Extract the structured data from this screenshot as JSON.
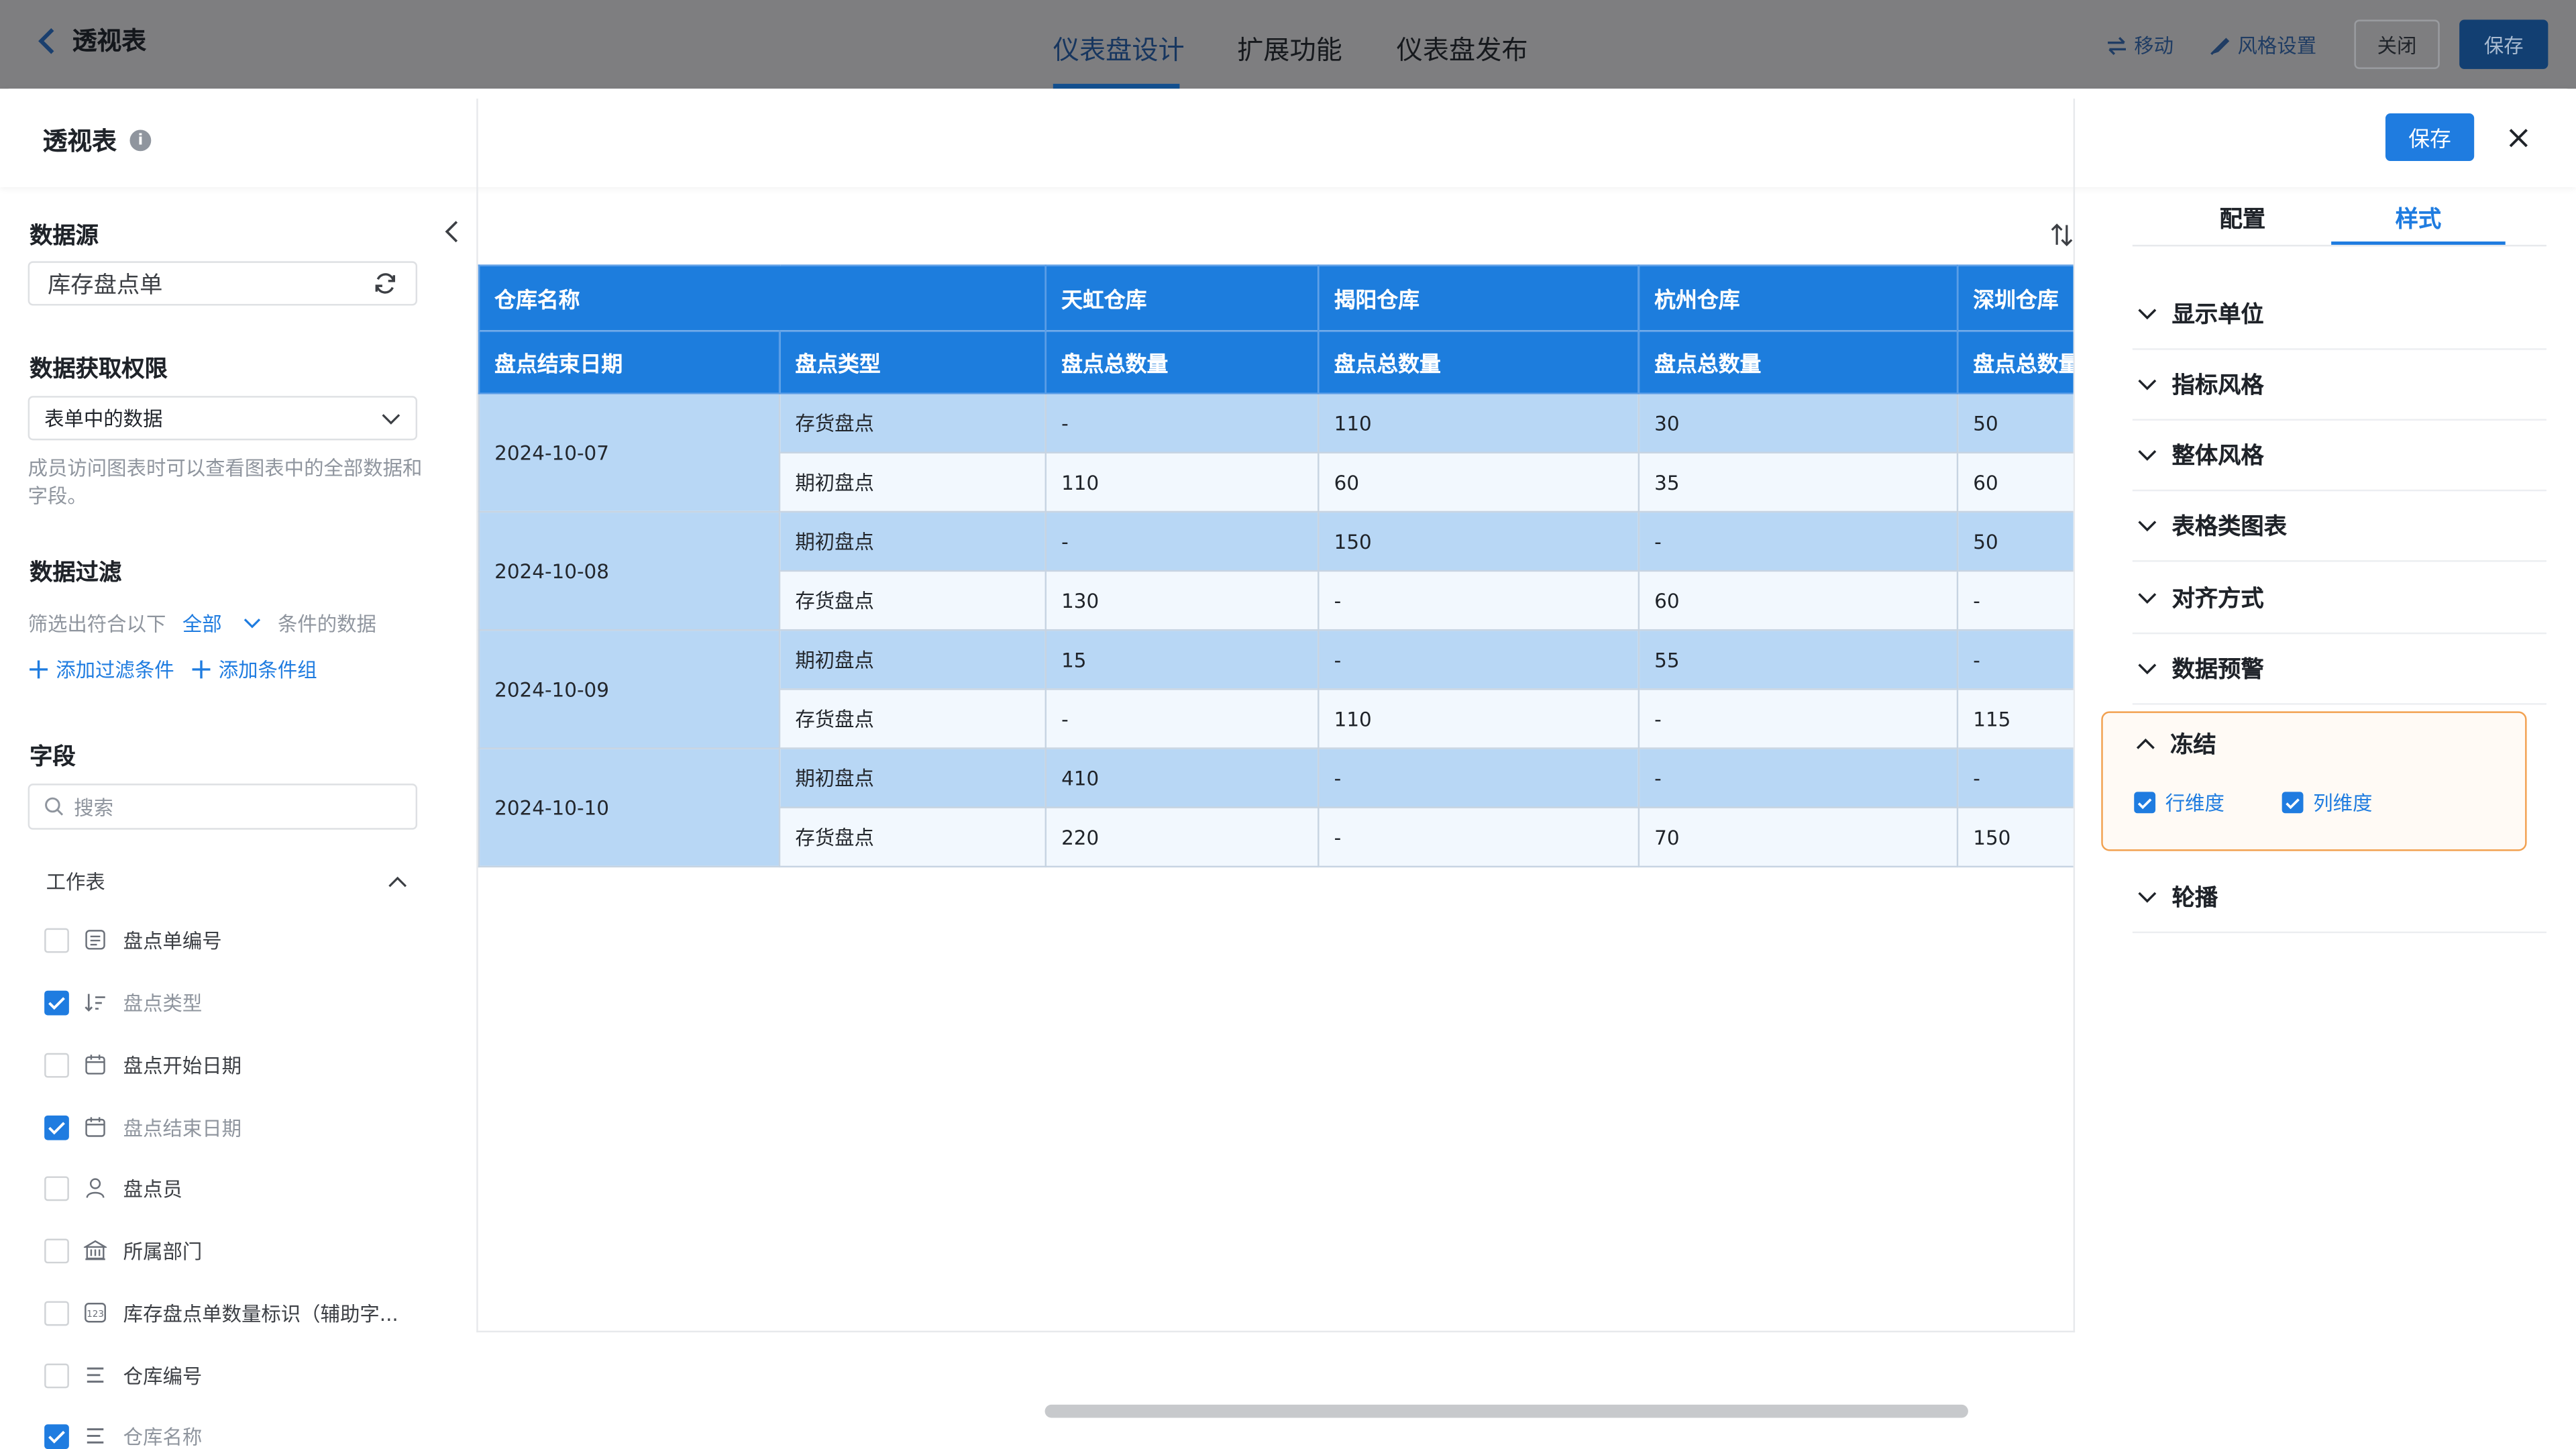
{
  "topbar": {
    "back_label": "透视表",
    "nav_tabs": [
      "仪表盘设计",
      "扩展功能",
      "仪表盘发布"
    ],
    "move_label": "移动",
    "style_label": "风格设置",
    "close_label": "关闭",
    "save_label": "保存"
  },
  "modal": {
    "title": "透视表",
    "info": "i",
    "save_label": "保存"
  },
  "left": {
    "datasource_title": "数据源",
    "datasource_value": "库存盘点单",
    "permission_title": "数据获取权限",
    "permission_value": "表单中的数据",
    "permission_hint": "成员访问图表时可以查看图表中的全部数据和字段。",
    "filter_title": "数据过滤",
    "filter_prefix": "筛选出符合以下",
    "filter_mode": "全部",
    "filter_suffix": "条件的数据",
    "add_filter": "添加过滤条件",
    "add_group": "添加条件组",
    "fields_title": "字段",
    "search_placeholder": "搜索",
    "worksheet_label": "工作表",
    "fields": [
      {
        "label": "盘点单编号",
        "checked": false,
        "icon": "text-field-icon"
      },
      {
        "label": "盘点类型",
        "checked": true,
        "icon": "sort-list-icon"
      },
      {
        "label": "盘点开始日期",
        "checked": false,
        "icon": "calendar-icon"
      },
      {
        "label": "盘点结束日期",
        "checked": true,
        "icon": "calendar-icon"
      },
      {
        "label": "盘点员",
        "checked": false,
        "icon": "user-icon"
      },
      {
        "label": "所属部门",
        "checked": false,
        "icon": "department-icon"
      },
      {
        "label": "库存盘点单数量标识（辅助字...",
        "checked": false,
        "icon": "number-icon"
      },
      {
        "label": "仓库编号",
        "checked": false,
        "icon": "lines-icon"
      },
      {
        "label": "仓库名称",
        "checked": true,
        "icon": "lines-icon"
      }
    ]
  },
  "table": {
    "corner_label": "仓库名称",
    "row_header_1": "盘点结束日期",
    "row_header_2": "盘点类型",
    "warehouses": [
      "天虹仓库",
      "揭阳仓库",
      "杭州仓库",
      "深圳仓库"
    ],
    "measure": "盘点总数量",
    "rows": [
      {
        "date": "2024-10-07",
        "type": "存货盘点",
        "values": [
          "-",
          "110",
          "30",
          "50"
        ]
      },
      {
        "date": "",
        "type": "期初盘点",
        "values": [
          "110",
          "60",
          "35",
          "60"
        ]
      },
      {
        "date": "2024-10-08",
        "type": "期初盘点",
        "values": [
          "-",
          "150",
          "-",
          "50"
        ]
      },
      {
        "date": "",
        "type": "存货盘点",
        "values": [
          "130",
          "-",
          "60",
          "-"
        ]
      },
      {
        "date": "2024-10-09",
        "type": "期初盘点",
        "values": [
          "15",
          "-",
          "55",
          "-"
        ]
      },
      {
        "date": "",
        "type": "存货盘点",
        "values": [
          "-",
          "110",
          "-",
          "115"
        ]
      },
      {
        "date": "2024-10-10",
        "type": "期初盘点",
        "values": [
          "410",
          "-",
          "-",
          "-"
        ]
      },
      {
        "date": "",
        "type": "存货盘点",
        "values": [
          "220",
          "-",
          "70",
          "150"
        ]
      }
    ]
  },
  "right": {
    "tabs": [
      "配置",
      "样式"
    ],
    "sections": [
      "显示单位",
      "指标风格",
      "整体风格",
      "表格类图表",
      "对齐方式",
      "数据预警"
    ],
    "freeze_title": "冻结",
    "freeze_row": "行维度",
    "freeze_col": "列维度",
    "carousel": "轮播"
  },
  "colors": {
    "accent": "#1f7ce0",
    "header_blue": "#1d7ddd",
    "cell_blue": "#b8d7f5",
    "highlight_border": "#f2a150"
  }
}
